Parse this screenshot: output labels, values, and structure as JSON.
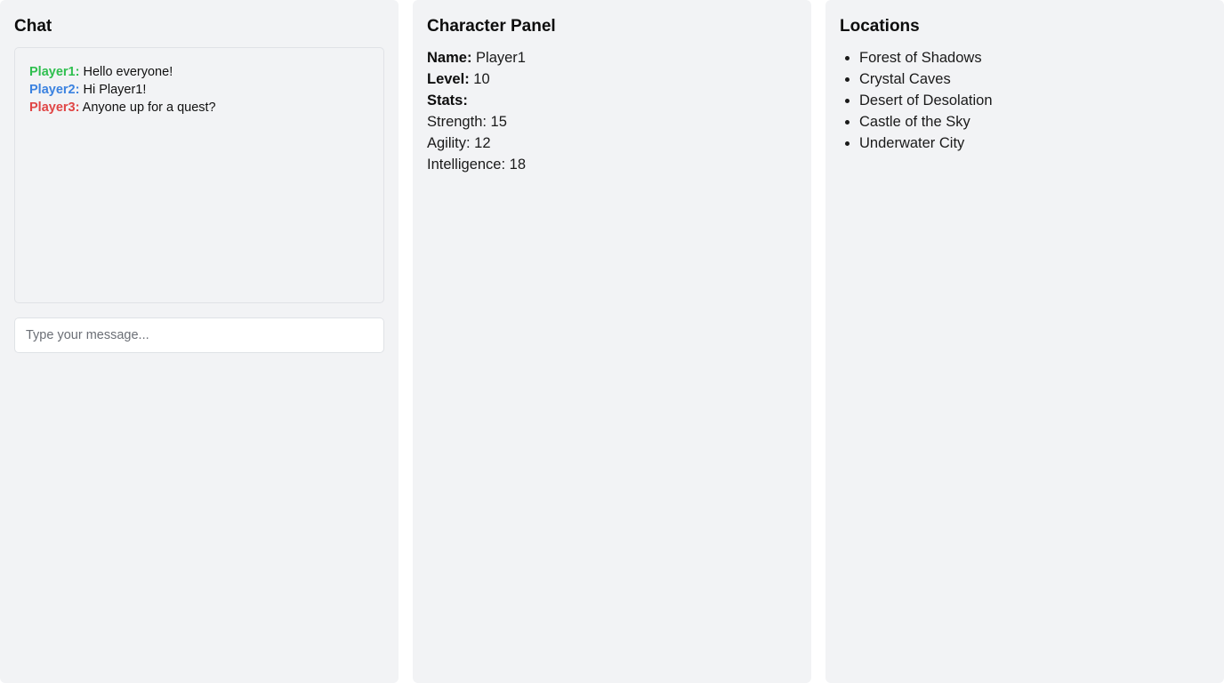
{
  "colors": {
    "panel_bg": "#f2f3f5",
    "player1": "#2fbf4f",
    "player2": "#3b82e0",
    "player3": "#e04545"
  },
  "chat": {
    "title": "Chat",
    "messages": [
      {
        "user": "Player1:",
        "text": "Hello everyone!",
        "color": "#2fbf4f"
      },
      {
        "user": "Player2:",
        "text": "Hi Player1!",
        "color": "#3b82e0"
      },
      {
        "user": "Player3:",
        "text": "Anyone up for a quest?",
        "color": "#e04545"
      }
    ],
    "input": {
      "placeholder": "Type your message...",
      "value": ""
    }
  },
  "character": {
    "title": "Character Panel",
    "name_label": "Name:",
    "name_value": "Player1",
    "level_label": "Level:",
    "level_value": "10",
    "stats_label": "Stats:",
    "stats": [
      "Strength: 15",
      "Agility: 12",
      "Intelligence: 18"
    ]
  },
  "locations": {
    "title": "Locations",
    "items": [
      "Forest of Shadows",
      "Crystal Caves",
      "Desert of Desolation",
      "Castle of the Sky",
      "Underwater City"
    ]
  }
}
